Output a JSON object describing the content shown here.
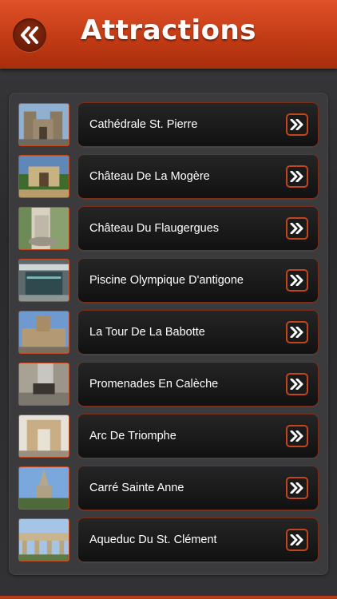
{
  "header": {
    "title": "Attractions",
    "back_icon": "double-chevron-left-icon",
    "accent": "#c23b15"
  },
  "list": {
    "items": [
      {
        "label": "Cathédrale St. Pierre",
        "thumb": "cathedral"
      },
      {
        "label": "Château De La Mogère",
        "thumb": "chateau-garden"
      },
      {
        "label": "Château Du Flaugergues",
        "thumb": "fountain"
      },
      {
        "label": "Piscine Olympique D'antigone",
        "thumb": "pool-building"
      },
      {
        "label": "La Tour De La Babotte",
        "thumb": "tower"
      },
      {
        "label": "Promenades En Calèche",
        "thumb": "horse-carriage"
      },
      {
        "label": "Arc De Triomphe",
        "thumb": "arch"
      },
      {
        "label": "Carré Sainte Anne",
        "thumb": "church-spire"
      },
      {
        "label": "Aqueduc Du St. Clément",
        "thumb": "aqueduct"
      }
    ],
    "arrow_icon": "double-chevron-right-icon"
  }
}
